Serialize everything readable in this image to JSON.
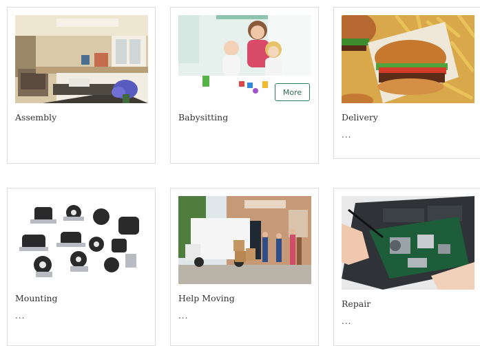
{
  "services": [
    {
      "title": "Assembly",
      "image_icon": "kitchen-photo"
    },
    {
      "title": "Babysitting",
      "image_icon": "family-photo",
      "more_label": "More"
    },
    {
      "title": "Delivery",
      "description": "...",
      "image_icon": "burger-fries-photo"
    },
    {
      "title": "Mounting",
      "description": "...",
      "image_icon": "engine-mounts-photo"
    },
    {
      "title": "Help Moving",
      "description": "...",
      "image_icon": "moving-truck-photo"
    },
    {
      "title": "Repair",
      "description": "...",
      "image_icon": "laptop-repair-photo"
    }
  ],
  "colors": {
    "card_border": "#dcdcdc",
    "button_border": "#2e7d5b",
    "button_text": "#2e6b53"
  }
}
